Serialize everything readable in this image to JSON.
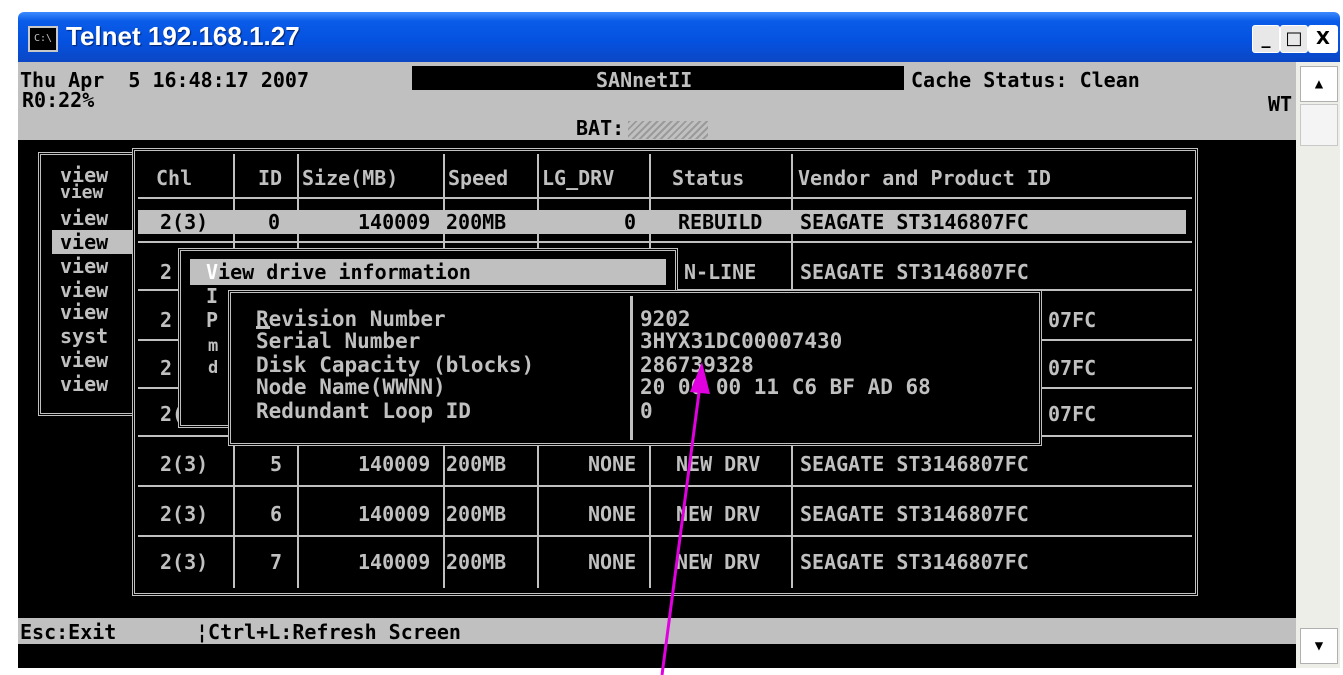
{
  "window": {
    "title": "Telnet 192.168.1.27",
    "icon": "console-icon",
    "controls": {
      "minimize": "_",
      "maximize": "□",
      "close": "X"
    }
  },
  "header": {
    "datetime": "Thu Apr  5 16:48:17 2007",
    "rebuild": "R0:22%",
    "app_name": "SANnetII",
    "cache_status": "Cache Status: Clean",
    "write_mode": "WT",
    "battery_label": "BAT:"
  },
  "menu_items": [
    "view",
    "view",
    "view",
    "view",
    "view",
    "view",
    "view",
    "syst",
    "view",
    "view"
  ],
  "table": {
    "columns": [
      "Chl",
      "ID",
      "Size(MB)",
      "Speed",
      "LG_DRV",
      "Status",
      "Vendor and Product ID"
    ],
    "rows": [
      {
        "chl": "2(3)",
        "id": "0",
        "size": "140009",
        "speed": "200MB",
        "lg_drv": "0",
        "status": "REBUILD",
        "vendor": "SEAGATE ST3146807FC"
      },
      {
        "chl": "2",
        "id": "",
        "size": "",
        "speed": "",
        "lg_drv": "",
        "status": "N-LINE",
        "vendor": "SEAGATE ST3146807FC"
      },
      {
        "chl": "2",
        "id": "",
        "size": "",
        "speed": "",
        "lg_drv": "",
        "status": "",
        "vendor": "07FC"
      },
      {
        "chl": "2",
        "id": "",
        "size": "",
        "speed": "",
        "lg_drv": "",
        "status": "",
        "vendor": "07FC"
      },
      {
        "chl": "2(3)",
        "id": "",
        "size": "",
        "speed": "",
        "lg_drv": "",
        "status": "",
        "vendor": "07FC"
      },
      {
        "chl": "2(3)",
        "id": "5",
        "size": "140009",
        "speed": "200MB",
        "lg_drv": "NONE",
        "status": "NEW DRV",
        "vendor": "SEAGATE ST3146807FC"
      },
      {
        "chl": "2(3)",
        "id": "6",
        "size": "140009",
        "speed": "200MB",
        "lg_drv": "NONE",
        "status": "NEW DRV",
        "vendor": "SEAGATE ST3146807FC"
      },
      {
        "chl": "2(3)",
        "id": "7",
        "size": "140009",
        "speed": "200MB",
        "lg_drv": "NONE",
        "status": "NEW DRV",
        "vendor": "SEAGATE ST3146807FC"
      }
    ]
  },
  "submenu": {
    "title": "View drive information",
    "first_letter": "V",
    "rest": "iew drive information",
    "letters": [
      "I",
      "P",
      "m",
      "d"
    ]
  },
  "info_dialog": {
    "labels": [
      "Revision Number",
      "Serial Number",
      "Disk Capacity (blocks)",
      "Node Name(WWNN)",
      "Redundant Loop ID"
    ],
    "values": [
      "9202",
      "3HYX31DC00007430",
      "286739328",
      "20 00 00 11 C6 BF AD 68",
      "0"
    ]
  },
  "status_bar": {
    "exit": "Esc:Exit",
    "refresh": "¦Ctrl+L:Refresh Screen"
  },
  "colors": {
    "titlebar": "#0551df",
    "console_bg": "#000000",
    "console_fg": "#c0c0c0",
    "arrow": "#e000e0"
  }
}
